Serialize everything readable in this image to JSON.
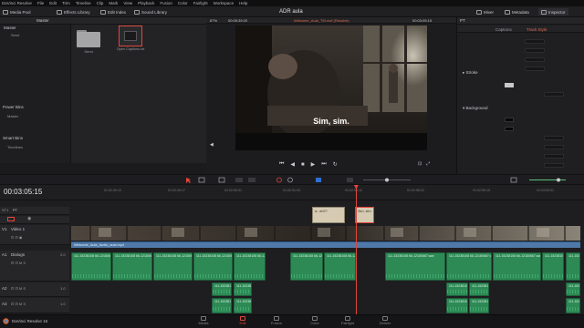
{
  "app": {
    "title": "DaVinci Resolve",
    "version_label": "DaVinci Resolve 15",
    "project_title": "ADR aula"
  },
  "menu": [
    "DaVinci Resolve",
    "File",
    "Edit",
    "Trim",
    "Timeline",
    "Clip",
    "Mark",
    "View",
    "Playback",
    "Fusion",
    "Color",
    "Fairlight",
    "Workspace",
    "Help"
  ],
  "toolbar": {
    "media_pool": "Media Pool",
    "effects_library": "Effects Library",
    "edit_index": "Edit Index",
    "sound_library": "Sound Library",
    "mixer": "Mixer",
    "metadata": "Metadata",
    "inspector": "Inspector"
  },
  "bins": {
    "header": "Master",
    "items": [
      "Master",
      "Send"
    ],
    "power_bins": "Power Bins",
    "power_items": [
      "Master"
    ],
    "smart_bins": "Smart Bins",
    "smart_items": [
      "Timelines"
    ]
  },
  "media_pool": {
    "header": "Master",
    "items": [
      {
        "label": "Send",
        "type": "folder"
      },
      {
        "label": "Open Captions.srt",
        "type": "file"
      }
    ]
  },
  "viewer": {
    "zoom": "87%",
    "source_tc": "00:05:39:20",
    "clip_name": "Welcome_Aula_TM.mxf (Resolve)",
    "program_tc": "00:03:05:15",
    "subtitle": "Sim, sim."
  },
  "inspector": {
    "header": "PT",
    "tabs": [
      "Captions",
      "Track Style"
    ],
    "active_tab": "Track Style",
    "sections": [
      "Stroke",
      "Background"
    ]
  },
  "timeline": {
    "timecode": "00:03:05:15",
    "ruler": [
      "01:02:49:12",
      "01:02:49:17",
      "01:02:50:01",
      "01:02:51:03",
      "01:02:56:12",
      "01:02:58:22",
      "01:02:59:15",
      "01:03:00:01"
    ],
    "playhead_frac": 0.555
  },
  "tracks": {
    "subtitle": {
      "name": "PT",
      "id": "ST1",
      "clips": [
        {
          "label": "á...a02?"
        },
        {
          "label": "Sim, sim."
        }
      ]
    },
    "video": {
      "id": "V1",
      "name": "Video 1",
      "audio_strip": "Welcome_Aula_Audio_aula.mp4"
    },
    "a1": {
      "id": "A1",
      "name": "Dialogs",
      "level": "2.0"
    },
    "a2": {
      "id": "A2",
      "level": "1.0"
    },
    "a3": {
      "id": "A3",
      "level": "1.0"
    }
  },
  "audio_clip_label": "111-15238108 66-12180667.wav",
  "pages": [
    "Media",
    "Edit",
    "Fusion",
    "Color",
    "Fairlight",
    "Deliver"
  ],
  "active_page": "Edit",
  "colors": {
    "audio": "#2d8a55",
    "accent": "#e0463a",
    "caption": "#d6cbb2"
  }
}
